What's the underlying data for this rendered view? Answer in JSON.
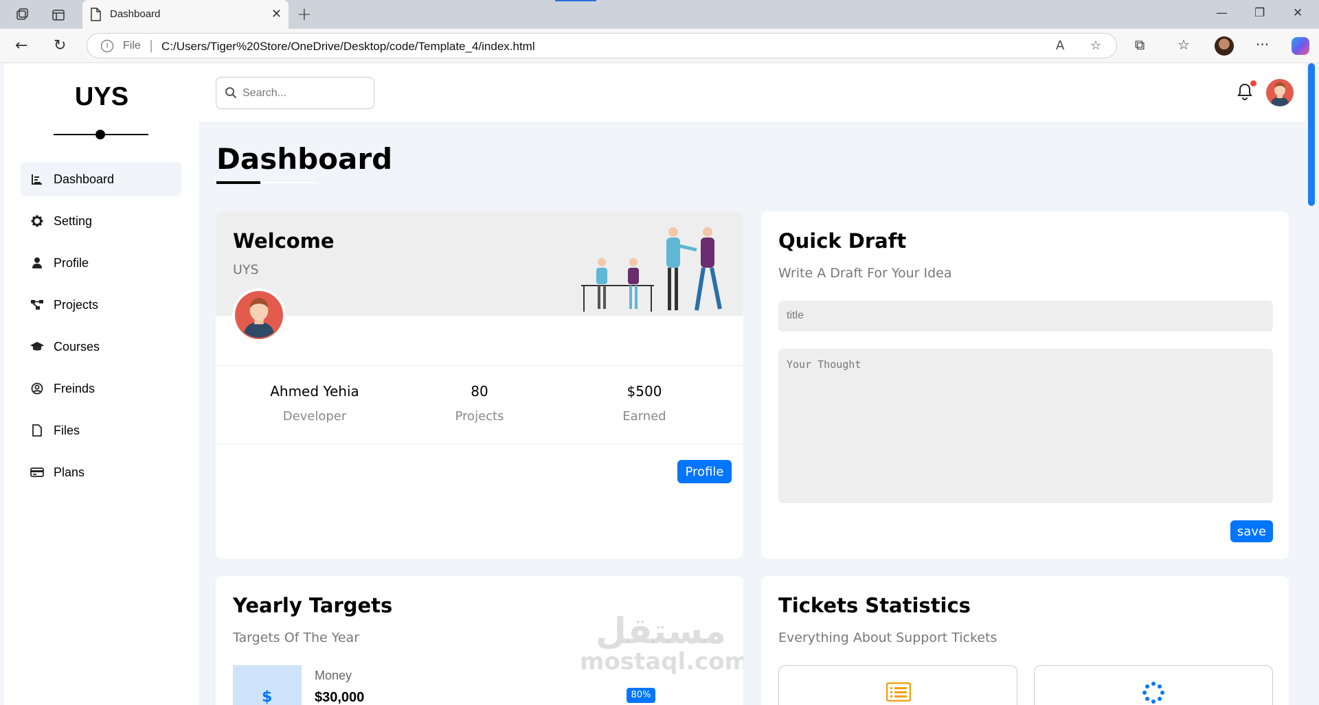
{
  "browser": {
    "tab_title": "Dashboard",
    "url_scheme_label": "File",
    "url": "C:/Users/Tiger%20Store/OneDrive/Desktop/code/Template_4/index.html"
  },
  "sidebar": {
    "logo": "UYS",
    "items": [
      {
        "label": "Dashboard",
        "icon": "chart-icon",
        "active": true
      },
      {
        "label": "Setting",
        "icon": "gear-icon"
      },
      {
        "label": "Profile",
        "icon": "user-icon"
      },
      {
        "label": "Projects",
        "icon": "diagram-icon"
      },
      {
        "label": "Courses",
        "icon": "graduation-cap-icon"
      },
      {
        "label": "Freinds",
        "icon": "user-circle-icon"
      },
      {
        "label": "Files",
        "icon": "file-icon"
      },
      {
        "label": "Plans",
        "icon": "credit-card-icon"
      }
    ]
  },
  "header": {
    "search_placeholder": "Search..."
  },
  "main": {
    "title": "Dashboard",
    "welcome": {
      "heading": "Welcome",
      "subheading": "UYS",
      "stats": [
        {
          "value": "Ahmed Yehia",
          "label": "Developer"
        },
        {
          "value": "80",
          "label": "Projects"
        },
        {
          "value": "$500",
          "label": "Earned"
        }
      ],
      "button": "Profile"
    },
    "draft": {
      "heading": "Quick Draft",
      "subheading": "Write A Draft For Your Idea",
      "title_placeholder": "title",
      "body_placeholder": "Your Thought",
      "button": "save"
    },
    "targets": {
      "heading": "Yearly Targets",
      "subheading": "Targets Of The Year",
      "first": {
        "label": "Money",
        "value": "$30,000",
        "progress_label": "80%",
        "progress": 0.8
      },
      "icon_symbol": "$"
    },
    "tickets": {
      "heading": "Tickets Statistics",
      "subheading": "Everything About Support Tickets"
    }
  },
  "colors": {
    "accent": "#0075ff",
    "page_bg": "#f1f5f9",
    "notification": "#f44336"
  },
  "watermark": {
    "arabic": "مستقل",
    "latin": "mostaql.com"
  }
}
